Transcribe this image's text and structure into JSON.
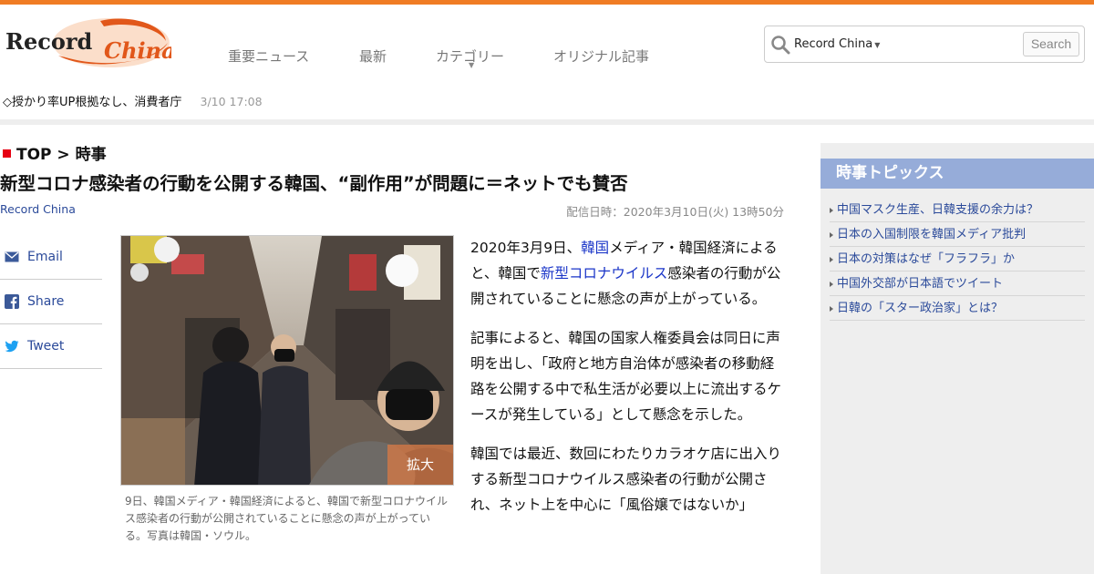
{
  "header": {
    "logo_text_a": "Record",
    "logo_text_b": "China",
    "nav": [
      {
        "label": "重要ニュース"
      },
      {
        "label": "最新"
      },
      {
        "label": "カテゴリー"
      },
      {
        "label": "オリジナル記事"
      }
    ],
    "search": {
      "scope": "Record China",
      "placeholder": "",
      "button": "Search"
    },
    "ticker": {
      "text": "◇授かり率UP根拠なし、消費者庁",
      "time": "3/10 17:08"
    }
  },
  "article": {
    "breadcrumb": "TOP > 時事",
    "title": "新型コロナ感染者の行動を公開する韓国、“副作用”が問題に＝ネットでも賛否",
    "source": "Record China",
    "date": "配信日時：2020年3月10日(火) 13時50分",
    "share": [
      {
        "label": "Email",
        "icon": "mail-icon"
      },
      {
        "label": "Share",
        "icon": "facebook-icon"
      },
      {
        "label": "Tweet",
        "icon": "twitter-icon"
      }
    ],
    "zoom_label": "拡大",
    "caption": "9日、韓国メディア・韓国経済によると、韓国で新型コロナウイルス感染者の行動が公開されていることに懸念の声が上がっている。写真は韓国・ソウル。",
    "p1_a": "2020年3月9日、",
    "p1_link1": "韓国",
    "p1_b": "メディア・韓国経済によると、韓国で",
    "p1_link2": "新型コロナウイルス",
    "p1_c": "感染者の行動が公開されていることに懸念の声が上がっている。",
    "p2": "記事によると、韓国の国家人権委員会は同日に声明を出し、「政府と地方自治体が感染者の移動経路を公開する中で私生活が必要以上に流出するケースが発生している」として懸念を示した。",
    "p3": "韓国では最近、数回にわたりカラオケ店に出入りする新型コロナウイルス感染者の行動が公開され、ネット上を中心に「風俗嬢ではないか」"
  },
  "sidebar": {
    "heading": "時事トピックス",
    "topics": [
      "中国マスク生産、日韓支援の余力は？",
      "日本の入国制限を韓国メディア批判",
      "日本の対策はなぜ「フラフラ」か",
      "中国外交部が日本語でツイート",
      "日韓の「スター政治家」とは？"
    ]
  },
  "colors": {
    "accent": "#f07c24",
    "link": "#2b4a9a",
    "sidebar_head": "#96acd9",
    "breadcrumb_square": "#e60012"
  }
}
